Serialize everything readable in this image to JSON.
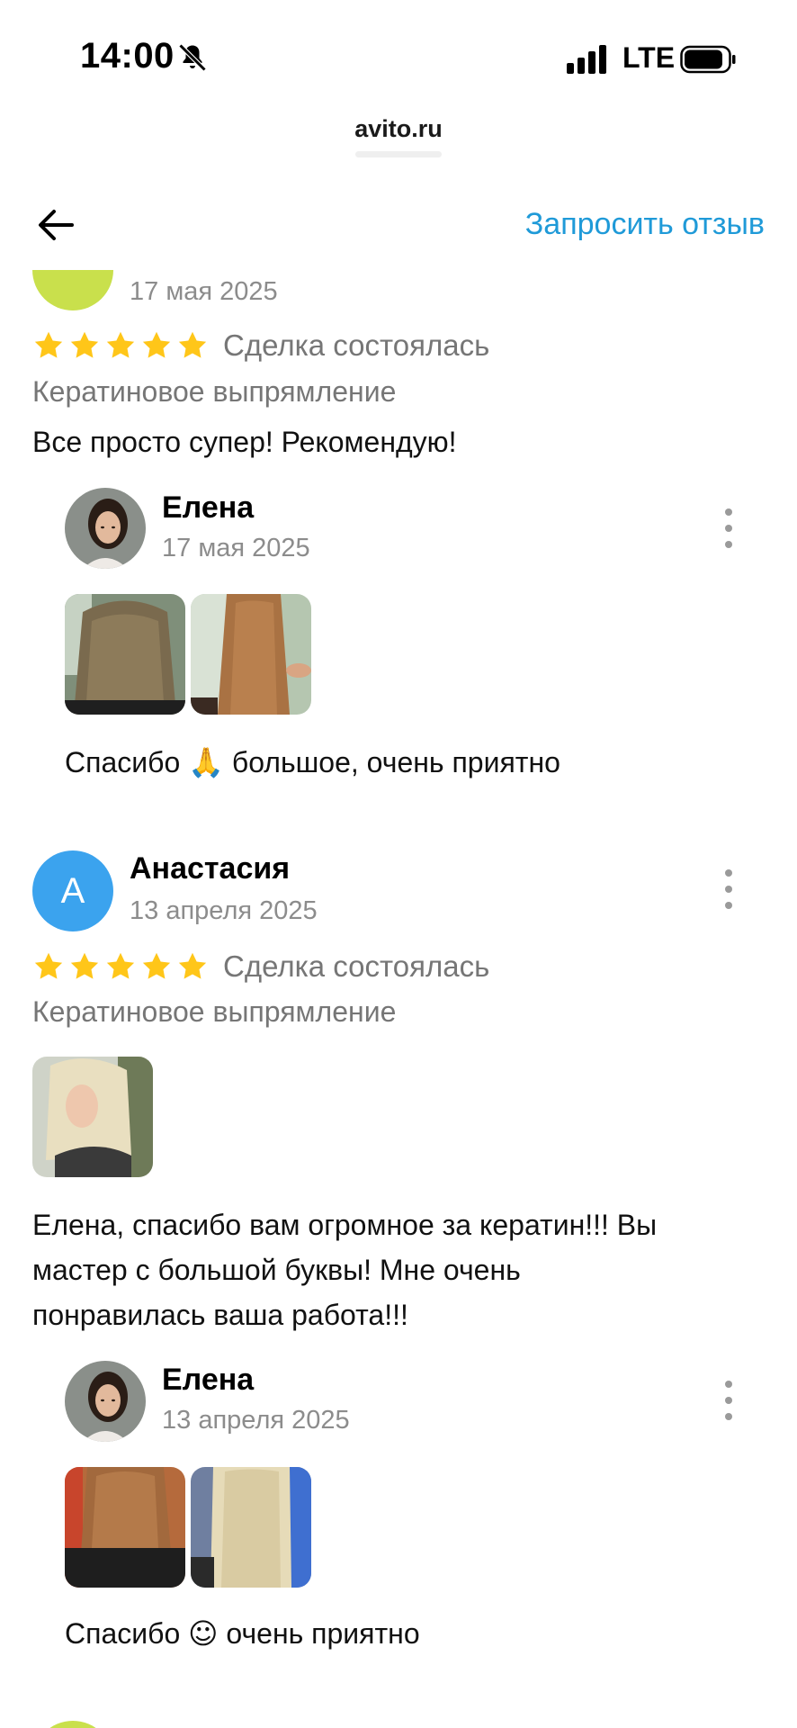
{
  "status_bar": {
    "time": "14:00",
    "network": "LTE"
  },
  "url_bar": {
    "domain": "avito.ru"
  },
  "header": {
    "request_review_label": "Запросить отзыв"
  },
  "reviews": [
    {
      "date": "17 мая 2025",
      "deal_status": "Сделка состоялась",
      "service": "Кератиновое выпрямление",
      "text": "Все просто супер! Рекомендую!",
      "rating": 5,
      "avatar_color": "#c9e04c",
      "reply": {
        "author": "Елена",
        "date": "17 мая 2025",
        "text_before": "Спасибо ",
        "emoji": "🙏",
        "text_after": " большое, очень приятно"
      }
    },
    {
      "author": "Анастасия",
      "avatar_letter": "А",
      "date": "13 апреля 2025",
      "deal_status": "Сделка состоялась",
      "service": "Кератиновое выпрямление",
      "text_lines": [
        "Елена, спасибо вам огромное за кератин!!! Вы",
        "мастер с большой буквы! Мне очень",
        "понравилась ваша работа!!!"
      ],
      "rating": 5,
      "avatar_color": "#3ba3ee",
      "reply": {
        "author": "Елена",
        "date": "13 апреля 2025",
        "text_before": "Спасибо ",
        "emoji": "☺",
        "text_after": " очень приятно"
      }
    }
  ],
  "colors": {
    "accent": "#1f9ad8",
    "star": "#ffc619",
    "secondary_text": "#767676"
  }
}
